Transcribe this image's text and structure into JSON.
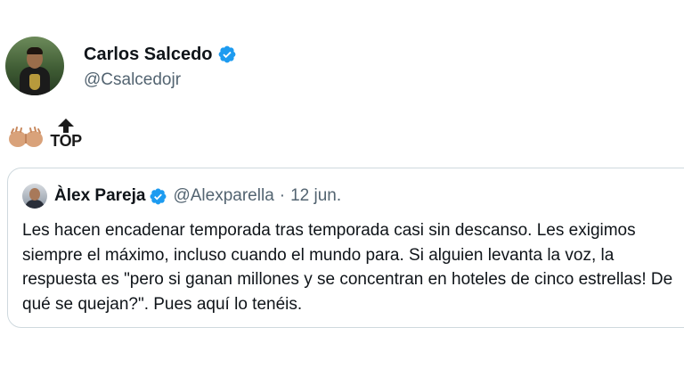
{
  "tweet": {
    "author": {
      "display_name": "Carlos Salcedo",
      "handle": "@Csalcedojr",
      "verified": true
    },
    "body": {
      "emoji": [
        "raised-hands-icon",
        "top-arrow-icon"
      ],
      "top_label": "TOP"
    }
  },
  "quoted_tweet": {
    "author": {
      "display_name": "Àlex Pareja",
      "handle": "@Alexparella",
      "verified": true
    },
    "separator": "·",
    "date": "12 jun.",
    "text": "Les hacen encadenar temporada tras temporada casi sin descanso. Les exigimos siempre el máximo, incluso cuando el mundo para. Si alguien levanta la voz, la respuesta es \"pero si ganan millones y se concentran en hoteles de cinco estrellas! De qué se quejan?\". Pues aquí lo tenéis."
  },
  "colors": {
    "verified_blue": "#1d9bf0",
    "secondary_text": "#536471",
    "border": "#cfd9de"
  }
}
